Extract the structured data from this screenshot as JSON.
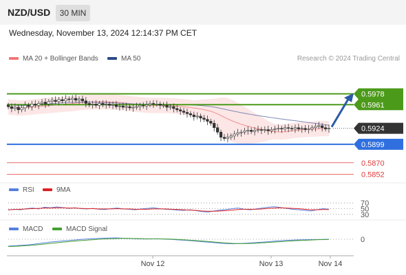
{
  "header": {
    "pair": "NZD/USD",
    "timeframe": "30 MIN"
  },
  "timestamp": "Wednesday, November 13, 2024 12:14:37 PM CET",
  "credit": "Research © 2024 Trading Central",
  "colors": {
    "ma20": "#f07878",
    "ma50": "#2c4a8a",
    "green": "#4c9a1a",
    "blue": "#2f6fdf",
    "red": "#e03a3a",
    "dark": "#333333",
    "rsi": "#5580e0",
    "macd": "#5580e0",
    "signal": "#44a030"
  },
  "legends": {
    "ma20": "MA 20 + Bollinger Bands",
    "ma50": "MA 50",
    "rsi": "RSI",
    "rsi_ma": "9MA",
    "macd": "MACD",
    "macd_signal": "MACD Signal"
  },
  "chart_data": [
    {
      "type": "candlestick",
      "title": "NZD/USD 30 MIN",
      "ylim": [
        0.5845,
        0.5985
      ],
      "x_ticks": [
        "Nov 12",
        "Nov 13",
        "Nov 14"
      ],
      "levels": [
        {
          "value": 0.5978,
          "label": "0.5978",
          "color": "green",
          "style": "box"
        },
        {
          "value": 0.5961,
          "label": "0.5961",
          "color": "green",
          "style": "box"
        },
        {
          "value": 0.5924,
          "label": "0.5924",
          "color": "dark",
          "style": "box"
        },
        {
          "value": 0.5899,
          "label": "0.5899",
          "color": "blue",
          "style": "box"
        },
        {
          "value": 0.587,
          "label": "0.5870",
          "color": "red",
          "style": "text"
        },
        {
          "value": 0.5852,
          "label": "0.5852",
          "color": "red",
          "style": "text"
        }
      ],
      "close": [
        0.5958,
        0.5955,
        0.5957,
        0.5953,
        0.5956,
        0.596,
        0.5958,
        0.5962,
        0.596,
        0.5963,
        0.5965,
        0.5962,
        0.5966,
        0.5968,
        0.5966,
        0.5969,
        0.5967,
        0.597,
        0.5969,
        0.5971,
        0.5968,
        0.597,
        0.5967,
        0.5963,
        0.5961,
        0.5962,
        0.596,
        0.5963,
        0.5961,
        0.5962,
        0.596,
        0.5961,
        0.5958,
        0.5959,
        0.5957,
        0.5958,
        0.5956,
        0.5957,
        0.5958,
        0.596,
        0.5959,
        0.5961,
        0.5963,
        0.5962,
        0.5962,
        0.596,
        0.596,
        0.5957,
        0.5958,
        0.5955,
        0.5953,
        0.5951,
        0.5949,
        0.5947,
        0.5945,
        0.5942,
        0.5943,
        0.594,
        0.5938,
        0.5935,
        0.5932,
        0.5925,
        0.5918,
        0.591,
        0.5908,
        0.591,
        0.5912,
        0.5915,
        0.5917,
        0.5918,
        0.592,
        0.5921,
        0.5919,
        0.5921,
        0.5922,
        0.5921,
        0.5922,
        0.592,
        0.5922,
        0.5923,
        0.5924,
        0.5923,
        0.5925,
        0.5924,
        0.5923,
        0.5925,
        0.5923,
        0.5924,
        0.5922,
        0.5923,
        0.5925,
        0.5927,
        0.5928,
        0.5925,
        0.5923,
        0.5924
      ]
    },
    {
      "type": "line",
      "title": "RSI",
      "ylim": [
        20,
        80
      ],
      "y_ticks": [
        "70",
        "50",
        "30"
      ],
      "series": [
        {
          "name": "RSI",
          "values": [
            45,
            48,
            46,
            50,
            52,
            49,
            55,
            53,
            56,
            54,
            51,
            53,
            50,
            49,
            51,
            48,
            47,
            50,
            52,
            49,
            48,
            46,
            49,
            51,
            53,
            50,
            48,
            47,
            45,
            44,
            46,
            43,
            40,
            38,
            42,
            45,
            47,
            50,
            52,
            48,
            46,
            49,
            52,
            55,
            57,
            54,
            51,
            48,
            46,
            44,
            42,
            46,
            50,
            48
          ]
        },
        {
          "name": "9MA",
          "values": [
            46,
            47,
            48,
            49,
            50,
            51,
            52,
            52,
            53,
            53,
            52,
            52,
            51,
            50,
            50,
            49,
            49,
            49,
            50,
            49,
            49,
            48,
            48,
            48,
            49,
            49,
            49,
            48,
            47,
            46,
            45,
            44,
            42,
            41,
            41,
            42,
            43,
            45,
            47,
            48,
            48,
            48,
            49,
            51,
            52,
            53,
            52,
            51,
            50,
            48,
            46,
            46,
            47,
            47
          ]
        }
      ]
    },
    {
      "type": "line",
      "title": "MACD",
      "y_ticks": [
        "0"
      ],
      "series": [
        {
          "name": "MACD",
          "values": [
            -0.003,
            -0.0027,
            -0.0024,
            -0.0018,
            -0.0012,
            -0.0008,
            -0.0004,
            0.0,
            0.0003,
            0.0005,
            0.0006,
            0.0004,
            0.0002,
            0.0001,
            0.0002,
            0.0,
            -0.0003,
            -0.0006,
            -0.001,
            -0.0014,
            -0.0018,
            -0.002,
            -0.0018,
            -0.0015,
            -0.0012,
            -0.0008,
            -0.0005,
            -0.0003,
            -0.0002,
            -0.0001,
            0.0
          ]
        },
        {
          "name": "MACD Signal",
          "values": [
            -0.0032,
            -0.003,
            -0.0027,
            -0.0023,
            -0.0018,
            -0.0013,
            -0.0009,
            -0.0005,
            -0.0002,
            0.0001,
            0.0003,
            0.0004,
            0.0003,
            0.0002,
            0.0002,
            0.0001,
            -0.0001,
            -0.0004,
            -0.0007,
            -0.0011,
            -0.0015,
            -0.0018,
            -0.0019,
            -0.0018,
            -0.0015,
            -0.0012,
            -0.0009,
            -0.0006,
            -0.0004,
            -0.0002,
            -0.0001
          ]
        }
      ]
    }
  ]
}
